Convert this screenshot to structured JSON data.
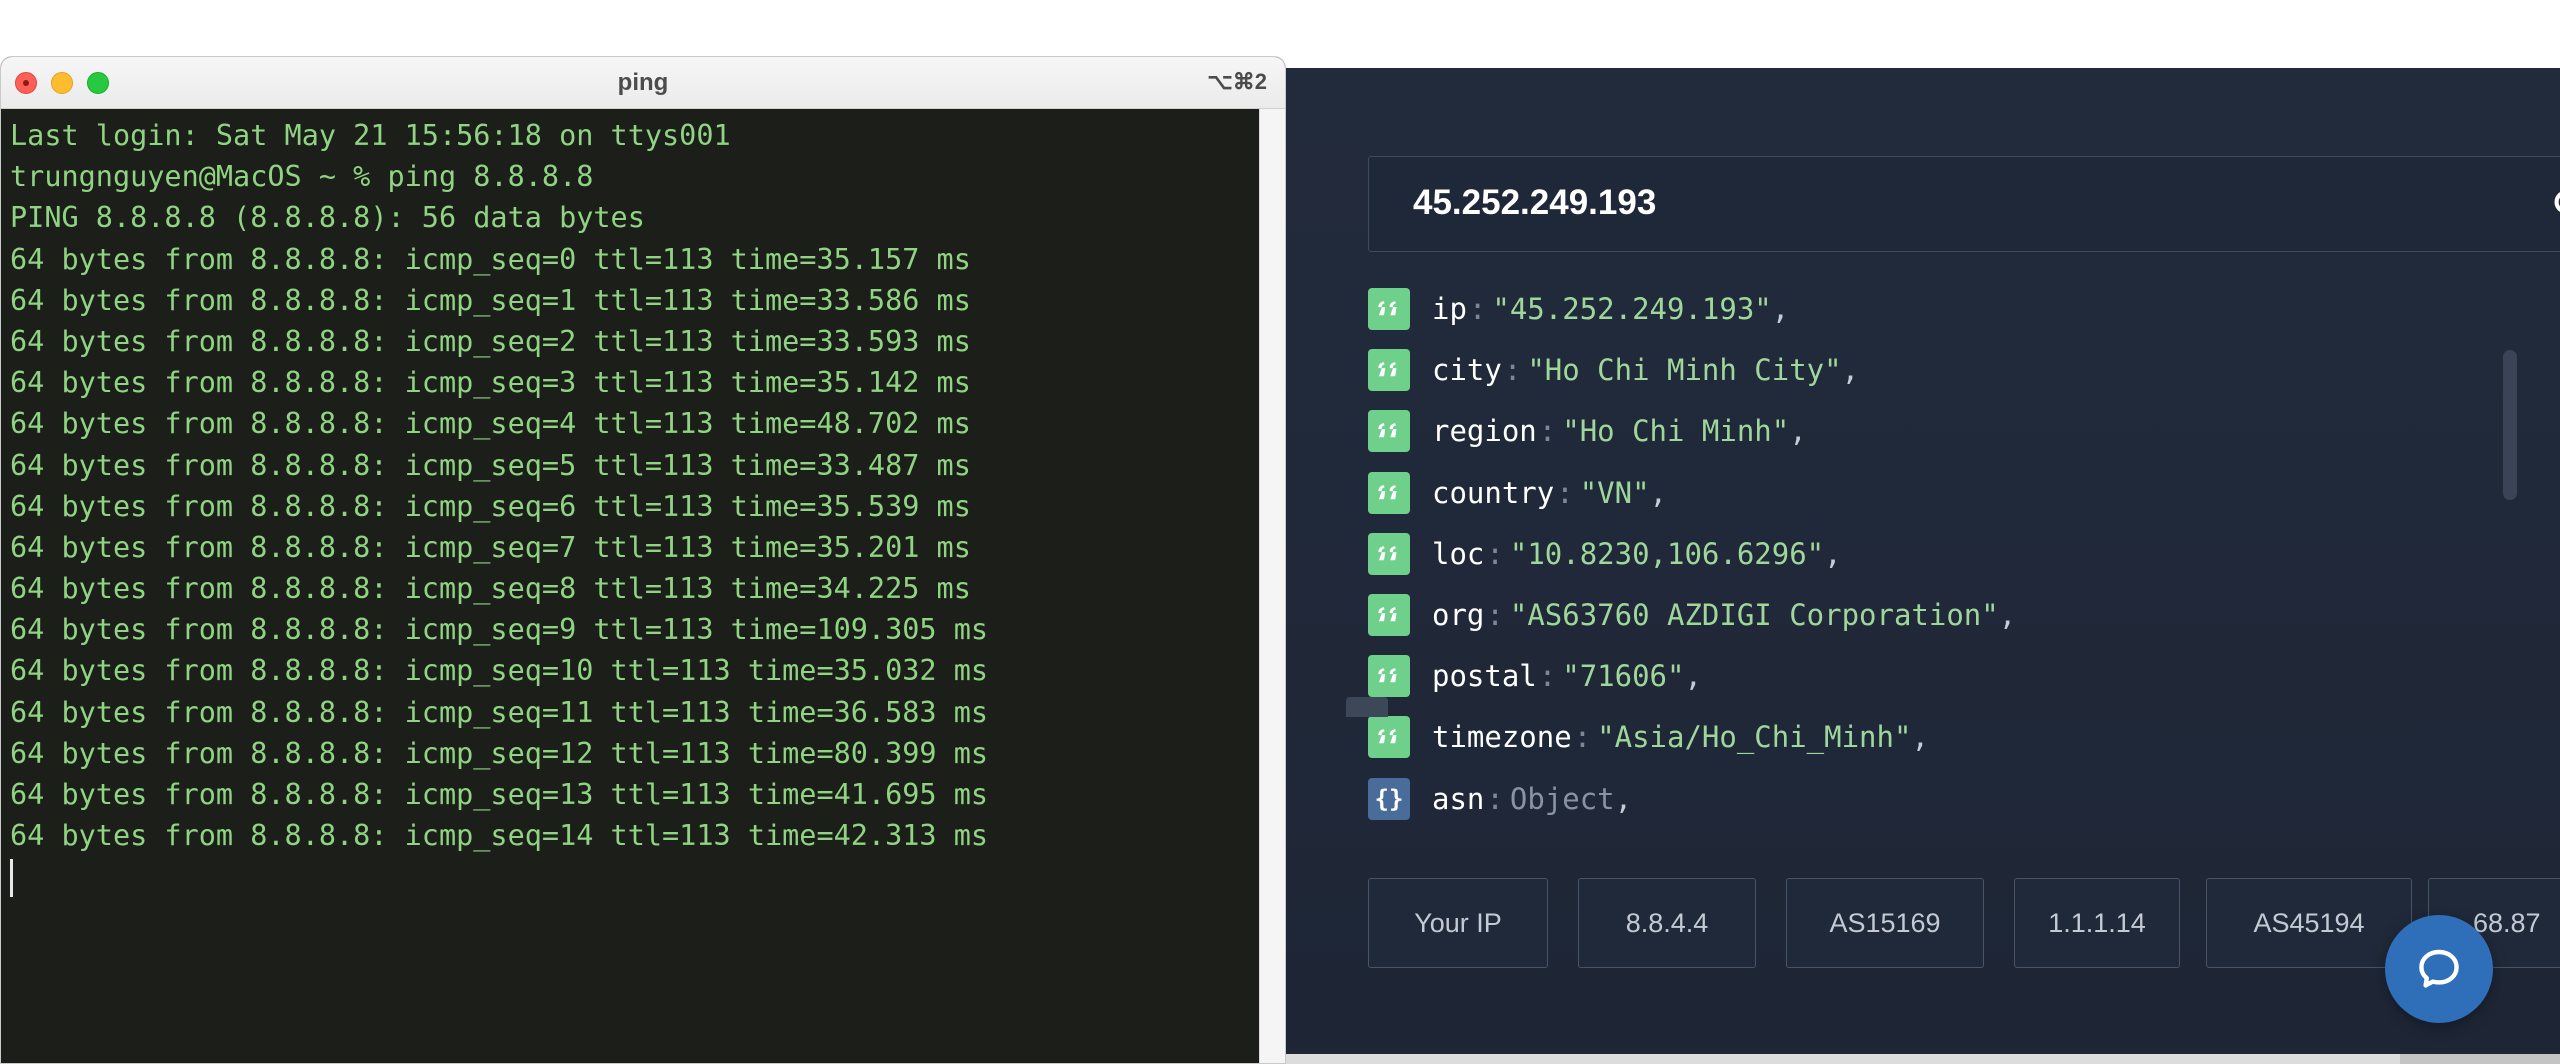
{
  "terminal": {
    "title": "ping",
    "shortcut": "⌥⌘2",
    "lines": [
      "Last login: Sat May 21 15:56:18 on ttys001",
      "trungnguyen@MacOS ~ % ping 8.8.8.8",
      "PING 8.8.8.8 (8.8.8.8): 56 data bytes",
      "64 bytes from 8.8.8.8: icmp_seq=0 ttl=113 time=35.157 ms",
      "64 bytes from 8.8.8.8: icmp_seq=1 ttl=113 time=33.586 ms",
      "64 bytes from 8.8.8.8: icmp_seq=2 ttl=113 time=33.593 ms",
      "64 bytes from 8.8.8.8: icmp_seq=3 ttl=113 time=35.142 ms",
      "64 bytes from 8.8.8.8: icmp_seq=4 ttl=113 time=48.702 ms",
      "64 bytes from 8.8.8.8: icmp_seq=5 ttl=113 time=33.487 ms",
      "64 bytes from 8.8.8.8: icmp_seq=6 ttl=113 time=35.539 ms",
      "64 bytes from 8.8.8.8: icmp_seq=7 ttl=113 time=35.201 ms",
      "64 bytes from 8.8.8.8: icmp_seq=8 ttl=113 time=34.225 ms",
      "64 bytes from 8.8.8.8: icmp_seq=9 ttl=113 time=109.305 ms",
      "64 bytes from 8.8.8.8: icmp_seq=10 ttl=113 time=35.032 ms",
      "64 bytes from 8.8.8.8: icmp_seq=11 ttl=113 time=36.583 ms",
      "64 bytes from 8.8.8.8: icmp_seq=12 ttl=113 time=80.399 ms",
      "64 bytes from 8.8.8.8: icmp_seq=13 ttl=113 time=41.695 ms",
      "64 bytes from 8.8.8.8: icmp_seq=14 ttl=113 time=42.313 ms"
    ]
  },
  "lookup": {
    "search_value": "45.252.249.193",
    "fields": [
      {
        "key": "ip",
        "value": "\"45.252.249.193\"",
        "type": "string"
      },
      {
        "key": "city",
        "value": "\"Ho Chi Minh City\"",
        "type": "string"
      },
      {
        "key": "region",
        "value": "\"Ho Chi Minh\"",
        "type": "string"
      },
      {
        "key": "country",
        "value": "\"VN\"",
        "type": "string"
      },
      {
        "key": "loc",
        "value": "\"10.8230,106.6296\"",
        "type": "string"
      },
      {
        "key": "org",
        "value": "\"AS63760 AZDIGI Corporation\"",
        "type": "string"
      },
      {
        "key": "postal",
        "value": "\"71606\"",
        "type": "string"
      },
      {
        "key": "timezone",
        "value": "\"Asia/Ho_Chi_Minh\"",
        "type": "string"
      },
      {
        "key": "asn",
        "value": "Object",
        "type": "object"
      }
    ],
    "object_badge": "{}",
    "chips": [
      "Your IP",
      "8.8.4.4",
      "AS15169",
      "1.1.1.14",
      "AS45194",
      "68.87"
    ]
  },
  "colors": {
    "terminal_bg": "#1c1f19",
    "terminal_text": "#8fd383",
    "panel_bg": "#222b3c",
    "string_badge": "#6ed08a",
    "object_badge": "#4a6c9b",
    "chat_button": "#2f6eb8"
  },
  "icons": {
    "string_badge": "quote-icon",
    "search": "search-icon",
    "chat": "chat-bubble-icon"
  }
}
